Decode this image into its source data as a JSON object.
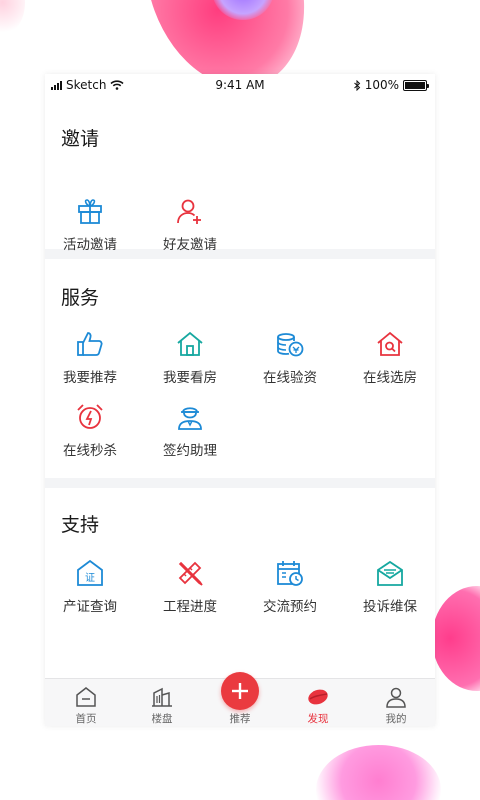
{
  "status_bar": {
    "carrier": "Sketch",
    "time": "9:41 AM",
    "battery": "100%",
    "battery_level": 1.0
  },
  "sections": {
    "invite": {
      "title": "邀请",
      "items": [
        {
          "label": "活动邀请",
          "icon": "gift-icon"
        },
        {
          "label": "好友邀请",
          "icon": "add-friend-icon"
        }
      ]
    },
    "service": {
      "title": "服务",
      "items": [
        {
          "label": "我要推荐",
          "icon": "thumbs-up-icon"
        },
        {
          "label": "我要看房",
          "icon": "house-icon"
        },
        {
          "label": "在线验资",
          "icon": "coins-icon"
        },
        {
          "label": "在线选房",
          "icon": "house-search-icon"
        },
        {
          "label": "在线秒杀",
          "icon": "alarm-clock-icon"
        },
        {
          "label": "签约助理",
          "icon": "assistant-icon"
        }
      ]
    },
    "support": {
      "title": "支持",
      "items": [
        {
          "label": "产证查询",
          "icon": "certificate-icon"
        },
        {
          "label": "工程进度",
          "icon": "pencil-ruler-icon"
        },
        {
          "label": "交流预约",
          "icon": "calendar-clock-icon"
        },
        {
          "label": "投诉维保",
          "icon": "mail-icon"
        }
      ]
    }
  },
  "tabbar": {
    "items": [
      {
        "label": "首页",
        "icon": "home-icon"
      },
      {
        "label": "楼盘",
        "icon": "buildings-icon"
      },
      {
        "label": "推荐",
        "icon": "plus-icon"
      },
      {
        "label": "发现",
        "icon": "discover-icon",
        "active": true
      },
      {
        "label": "我的",
        "icon": "user-icon"
      }
    ]
  },
  "colors": {
    "blue": "#1d8ad6",
    "red": "#e8333e",
    "teal": "#16a8a0",
    "accent": "#ea3a3f"
  }
}
